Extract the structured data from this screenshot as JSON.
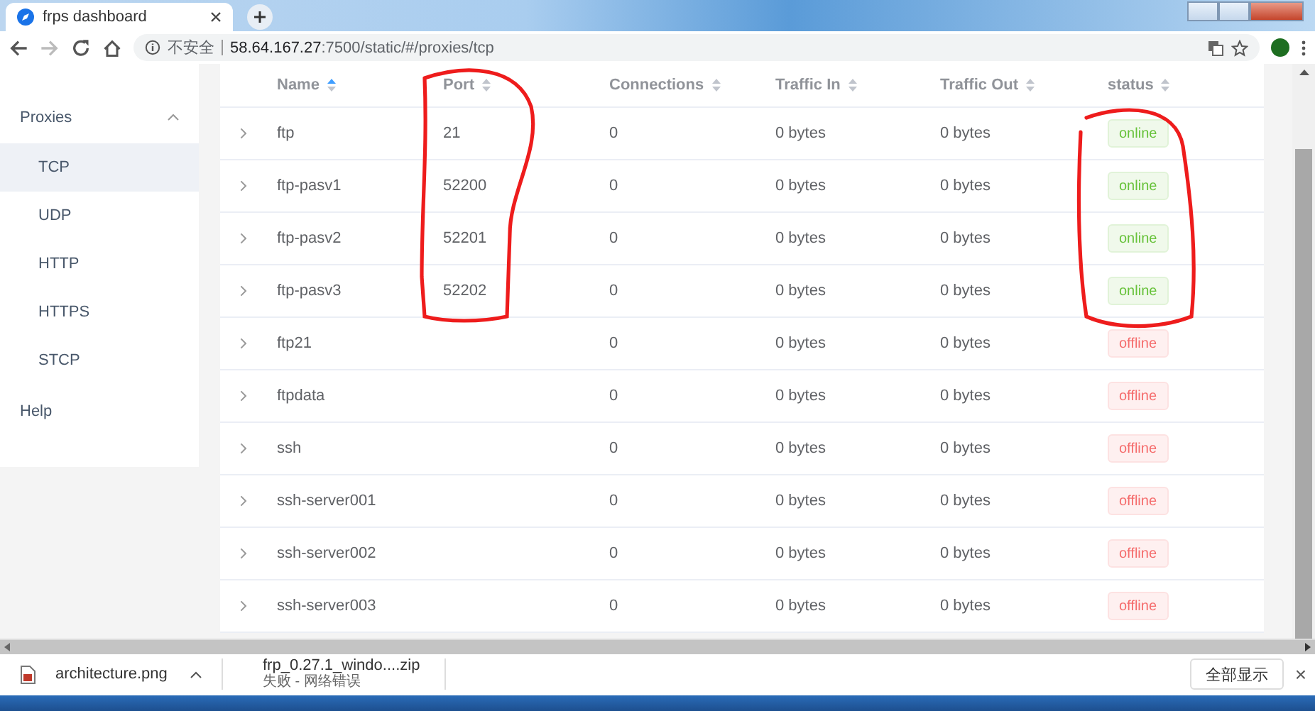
{
  "browser": {
    "tab": {
      "title": "frps dashboard"
    },
    "security_label": "不安全",
    "url": {
      "host": "58.64.167.27",
      "path": ":7500/static/#/proxies/tcp"
    }
  },
  "sidebar": {
    "group": {
      "label": "Proxies",
      "expanded": true,
      "items": [
        {
          "label": "TCP",
          "selected": true
        },
        {
          "label": "UDP",
          "selected": false
        },
        {
          "label": "HTTP",
          "selected": false
        },
        {
          "label": "HTTPS",
          "selected": false
        },
        {
          "label": "STCP",
          "selected": false
        }
      ]
    },
    "items": [
      {
        "label": "Help",
        "selected": false
      }
    ]
  },
  "table": {
    "columns": [
      {
        "label": "Name",
        "sorted": true
      },
      {
        "label": "Port",
        "sorted": false
      },
      {
        "label": "Connections",
        "sorted": false
      },
      {
        "label": "Traffic In",
        "sorted": false
      },
      {
        "label": "Traffic Out",
        "sorted": false
      },
      {
        "label": "status",
        "sorted": false
      }
    ],
    "rows": [
      {
        "name": "ftp",
        "port": "21",
        "connections": "0",
        "traffic_in": "0 bytes",
        "traffic_out": "0 bytes",
        "status": "online",
        "online": true
      },
      {
        "name": "ftp-pasv1",
        "port": "52200",
        "connections": "0",
        "traffic_in": "0 bytes",
        "traffic_out": "0 bytes",
        "status": "online",
        "online": true
      },
      {
        "name": "ftp-pasv2",
        "port": "52201",
        "connections": "0",
        "traffic_in": "0 bytes",
        "traffic_out": "0 bytes",
        "status": "online",
        "online": true
      },
      {
        "name": "ftp-pasv3",
        "port": "52202",
        "connections": "0",
        "traffic_in": "0 bytes",
        "traffic_out": "0 bytes",
        "status": "online",
        "online": true
      },
      {
        "name": "ftp21",
        "connections": "0",
        "traffic_in": "0 bytes",
        "traffic_out": "0 bytes",
        "status": "offline",
        "online": false
      },
      {
        "name": "ftpdata",
        "connections": "0",
        "traffic_in": "0 bytes",
        "traffic_out": "0 bytes",
        "status": "offline",
        "online": false
      },
      {
        "name": "ssh",
        "connections": "0",
        "traffic_in": "0 bytes",
        "traffic_out": "0 bytes",
        "status": "offline",
        "online": false
      },
      {
        "name": "ssh-server001",
        "connections": "0",
        "traffic_in": "0 bytes",
        "traffic_out": "0 bytes",
        "status": "offline",
        "online": false
      },
      {
        "name": "ssh-server002",
        "connections": "0",
        "traffic_in": "0 bytes",
        "traffic_out": "0 bytes",
        "status": "offline",
        "online": false
      },
      {
        "name": "ssh-server003",
        "connections": "0",
        "traffic_in": "0 bytes",
        "traffic_out": "0 bytes",
        "status": "offline",
        "online": false
      }
    ]
  },
  "annotations": [
    {
      "kind": "outline"
    },
    {
      "kind": "outline"
    }
  ],
  "downloads": {
    "items": [
      {
        "kind": "image",
        "filename": "architecture.png"
      },
      {
        "kind": "archive",
        "filename": "frp_0.27.1_windo....zip",
        "status": "失败 - 网络错误"
      }
    ],
    "show_all": "全部显示",
    "close": "×"
  }
}
